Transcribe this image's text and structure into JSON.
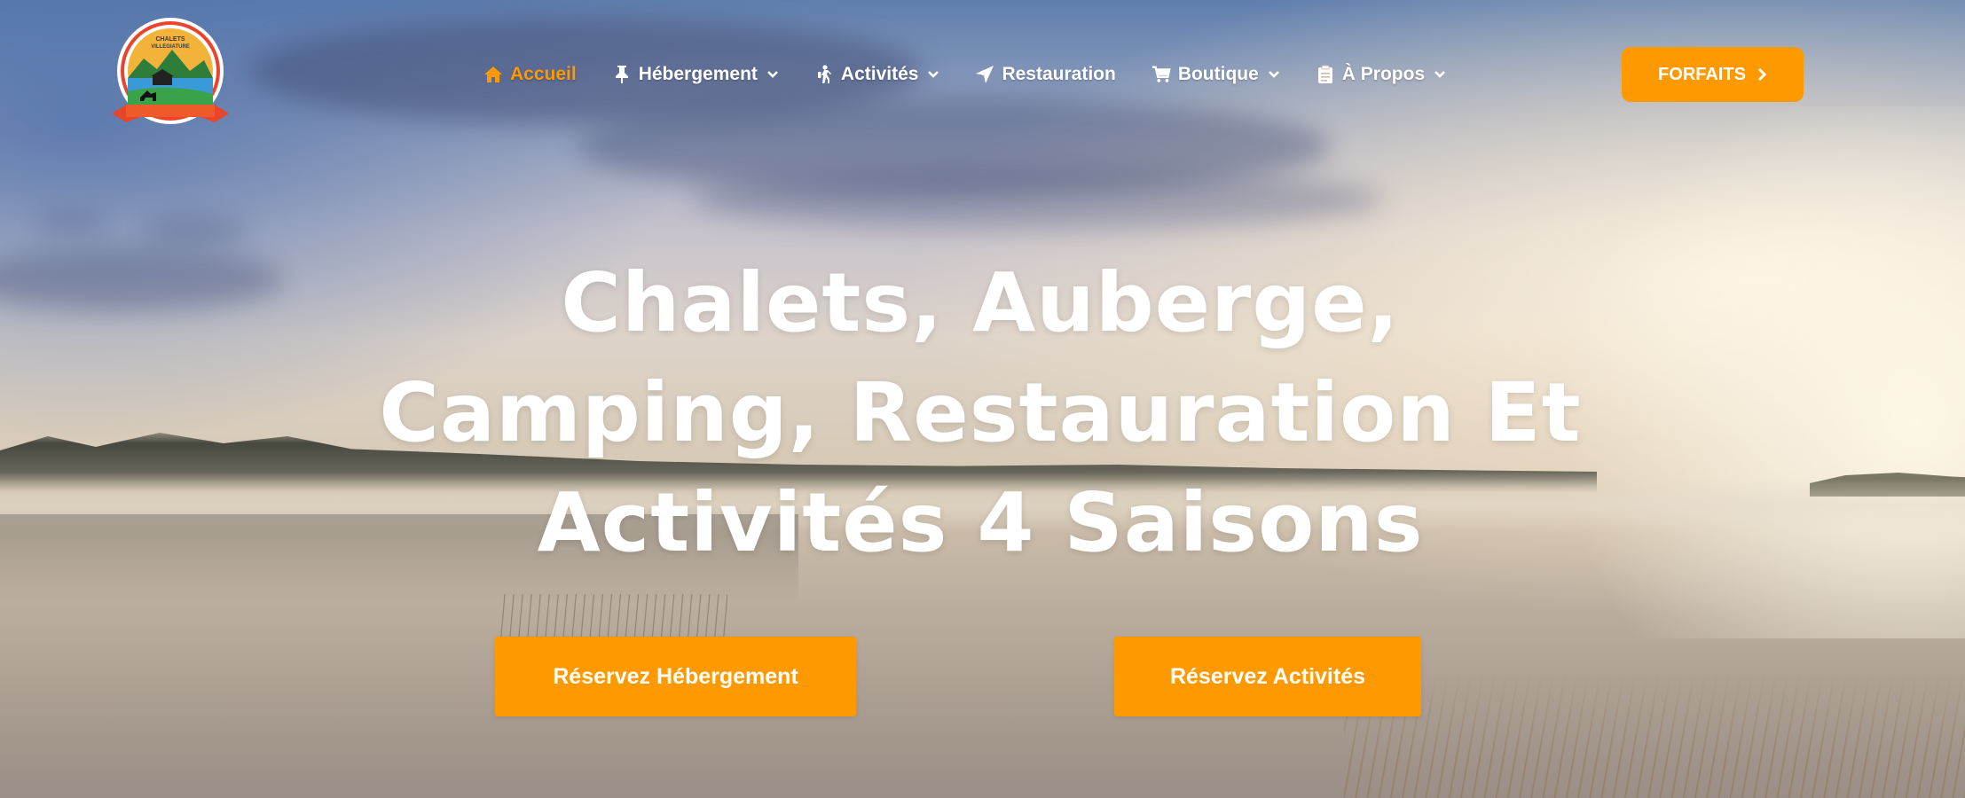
{
  "header": {
    "logo": {
      "text_top": "CHALETS",
      "text_mid": "VILLEGIATURE",
      "ribbon_text": ""
    },
    "nav": [
      {
        "label": "Accueil",
        "icon": "home-icon",
        "active": true,
        "dropdown": false
      },
      {
        "label": "Hébergement",
        "icon": "pushpin-icon",
        "active": false,
        "dropdown": true
      },
      {
        "label": "Activités",
        "icon": "hiker-icon",
        "active": false,
        "dropdown": true
      },
      {
        "label": "Restauration",
        "icon": "location-arrow-icon",
        "active": false,
        "dropdown": false
      },
      {
        "label": "Boutique",
        "icon": "cart-icon",
        "active": false,
        "dropdown": true
      },
      {
        "label": "À Propos",
        "icon": "clipboard-icon",
        "active": false,
        "dropdown": true
      }
    ],
    "cta": {
      "label": "FORFAITS",
      "icon": "chevron-right-icon"
    }
  },
  "hero": {
    "headline_lines": [
      "Chalets, Auberge,",
      "Camping, Restauration Et",
      "Activités 4 Saisons"
    ],
    "buttons": {
      "hebergement": "Réservez Hébergement",
      "activites": "Réservez Activités"
    }
  },
  "colors": {
    "accent": "#ff9900",
    "text_light": "#ffffff"
  }
}
